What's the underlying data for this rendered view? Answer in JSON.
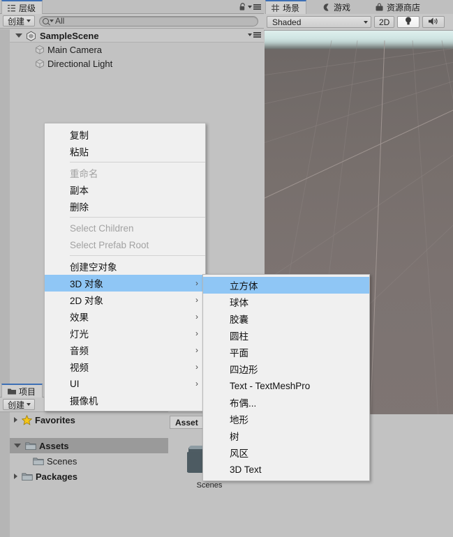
{
  "hierarchy": {
    "tab": {
      "label": "层级",
      "icon": "hierarchy-icon"
    },
    "create_button": "创建",
    "search": {
      "value": "All",
      "placeholder": "All"
    },
    "scene_name": "SampleScene",
    "objects": [
      {
        "label": "Main Camera",
        "icon": "cube-icon"
      },
      {
        "label": "Directional Light",
        "icon": "cube-icon"
      }
    ]
  },
  "scene": {
    "tabs": [
      {
        "label": "场景",
        "icon": "grid-icon",
        "active": true
      },
      {
        "label": "游戏",
        "icon": "gamepad-icon",
        "active": false
      },
      {
        "label": "资源商店",
        "icon": "store-icon",
        "active": false
      }
    ],
    "toolbar": {
      "shading_mode": "Shaded",
      "view_2d": "2D",
      "lighting_icon": "lightbulb-icon",
      "audio_icon": "speaker-icon"
    }
  },
  "project": {
    "tab": {
      "label": "项目",
      "icon": "folder-icon"
    },
    "create_button": "创建",
    "tree": [
      {
        "label": "Favorites",
        "icon": "star-icon",
        "expandable": true,
        "expanded": false,
        "depth": 0,
        "selected": false,
        "bold": true
      },
      {
        "label": "Assets",
        "icon": "folder-icon",
        "expandable": true,
        "expanded": true,
        "depth": 0,
        "selected": true,
        "bold": true
      },
      {
        "label": "Scenes",
        "icon": "folder-icon",
        "expandable": false,
        "expanded": false,
        "depth": 1,
        "selected": false,
        "bold": false
      },
      {
        "label": "Packages",
        "icon": "folder-icon",
        "expandable": true,
        "expanded": false,
        "depth": 0,
        "selected": false,
        "bold": true
      }
    ]
  },
  "assets": {
    "breadcrumb": "Asset",
    "items": [
      {
        "label": "Scenes",
        "icon": "folder-large-icon"
      }
    ]
  },
  "context_menu": {
    "items": [
      {
        "label": "复制",
        "type": "item",
        "disabled": false,
        "submenu": false,
        "highlighted": false
      },
      {
        "label": "粘贴",
        "type": "item",
        "disabled": false,
        "submenu": false,
        "highlighted": false
      },
      {
        "type": "separator"
      },
      {
        "label": "重命名",
        "type": "item",
        "disabled": true,
        "submenu": false,
        "highlighted": false
      },
      {
        "label": "副本",
        "type": "item",
        "disabled": false,
        "submenu": false,
        "highlighted": false
      },
      {
        "label": "删除",
        "type": "item",
        "disabled": false,
        "submenu": false,
        "highlighted": false
      },
      {
        "type": "separator"
      },
      {
        "label": "Select Children",
        "type": "item",
        "disabled": true,
        "submenu": false,
        "highlighted": false
      },
      {
        "label": "Select Prefab Root",
        "type": "item",
        "disabled": true,
        "submenu": false,
        "highlighted": false
      },
      {
        "type": "separator"
      },
      {
        "label": "创建空对象",
        "type": "item",
        "disabled": false,
        "submenu": false,
        "highlighted": false
      },
      {
        "label": "3D 对象",
        "type": "item",
        "disabled": false,
        "submenu": true,
        "highlighted": true
      },
      {
        "label": "2D 对象",
        "type": "item",
        "disabled": false,
        "submenu": true,
        "highlighted": false
      },
      {
        "label": "效果",
        "type": "item",
        "disabled": false,
        "submenu": true,
        "highlighted": false
      },
      {
        "label": "灯光",
        "type": "item",
        "disabled": false,
        "submenu": true,
        "highlighted": false
      },
      {
        "label": "音频",
        "type": "item",
        "disabled": false,
        "submenu": true,
        "highlighted": false
      },
      {
        "label": "视频",
        "type": "item",
        "disabled": false,
        "submenu": true,
        "highlighted": false
      },
      {
        "label": "UI",
        "type": "item",
        "disabled": false,
        "submenu": true,
        "highlighted": false
      },
      {
        "label": "摄像机",
        "type": "item",
        "disabled": false,
        "submenu": false,
        "highlighted": false
      }
    ],
    "submenu_arrow": "›"
  },
  "context_submenu": {
    "items": [
      {
        "label": "立方体",
        "highlighted": true
      },
      {
        "label": "球体",
        "highlighted": false
      },
      {
        "label": "胶囊",
        "highlighted": false
      },
      {
        "label": "圆柱",
        "highlighted": false
      },
      {
        "label": "平面",
        "highlighted": false
      },
      {
        "label": "四边形",
        "highlighted": false
      },
      {
        "label": "Text - TextMeshPro",
        "highlighted": false
      },
      {
        "label": "布偶...",
        "highlighted": false
      },
      {
        "label": "地形",
        "highlighted": false
      },
      {
        "label": "树",
        "highlighted": false
      },
      {
        "label": "风区",
        "highlighted": false
      },
      {
        "label": "3D Text",
        "highlighted": false
      }
    ]
  },
  "colors": {
    "menu_bg": "#f0f0f0",
    "highlight": "#8fc6f5",
    "panel_bg": "#c2c2c2",
    "toolbar_bg": "#c8c8c8",
    "active_tab_accent": "#3d6fb5",
    "selected_row": "#9a9a9a"
  }
}
